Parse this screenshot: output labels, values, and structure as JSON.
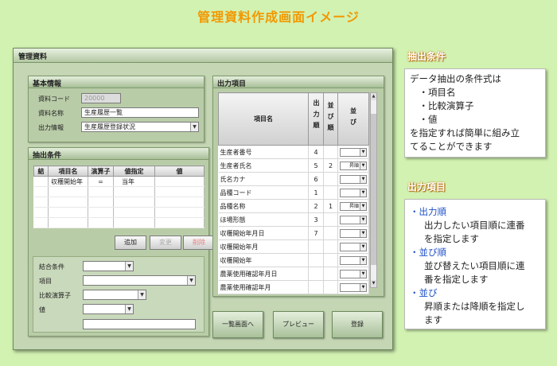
{
  "page_title": "管理資料作成画面イメージ",
  "window": {
    "title": "管理資料",
    "basic_info": {
      "header": "基本情報",
      "code_label": "資料コード",
      "code_value": "20000",
      "name_label": "資料名称",
      "name_value": "生産履歴一覧",
      "output_label": "出力情報",
      "output_value": "生産履歴登録状況"
    },
    "conditions": {
      "header": "抽出条件",
      "columns": [
        "結",
        "項目名",
        "演算子",
        "値指定",
        "値"
      ],
      "rows": [
        {
          "join": "",
          "item": "収穫開始年",
          "op": "=",
          "spec": "当年",
          "value": ""
        }
      ],
      "add_label": "追加",
      "change_label": "変更",
      "delete_label": "削除",
      "join_label": "結合条件",
      "item_label": "項目",
      "op_label": "比較演算子",
      "value_label": "値"
    },
    "output": {
      "header": "出力項目",
      "col_item": "項目名",
      "col_order": "出力順",
      "col_sort": "並び順",
      "col_dir": "並び",
      "rows": [
        {
          "name": "生産者番号",
          "order": "4",
          "sort": "",
          "dir": ""
        },
        {
          "name": "生産者氏名",
          "order": "5",
          "sort": "2",
          "dir": "昇順"
        },
        {
          "name": "氏名カナ",
          "order": "6",
          "sort": "",
          "dir": ""
        },
        {
          "name": "品種コード",
          "order": "1",
          "sort": "",
          "dir": ""
        },
        {
          "name": "品種名称",
          "order": "2",
          "sort": "1",
          "dir": "昇順"
        },
        {
          "name": "ほ場形態",
          "order": "3",
          "sort": "",
          "dir": ""
        },
        {
          "name": "収穫開始年月日",
          "order": "7",
          "sort": "",
          "dir": ""
        },
        {
          "name": "収穫開始年月",
          "order": "",
          "sort": "",
          "dir": ""
        },
        {
          "name": "収穫開始年",
          "order": "",
          "sort": "",
          "dir": ""
        },
        {
          "name": "農薬使用確認年月日",
          "order": "",
          "sort": "",
          "dir": ""
        },
        {
          "name": "農薬使用確認年月",
          "order": "",
          "sort": "",
          "dir": ""
        }
      ]
    },
    "buttons": {
      "list": "一覧画面へ",
      "preview": "プレビュー",
      "register": "登録"
    }
  },
  "side": {
    "cond_head": "抽出条件",
    "cond_lines": [
      "データ抽出の条件式は",
      "　・項目名",
      "　・比較演算子",
      "　・値",
      "を指定すれば簡単に組み立",
      "てることができます"
    ],
    "out_head": "出力項目",
    "out_items": [
      {
        "title": "・出力順",
        "desc": [
          "出力したい項目順に連番",
          "を指定します"
        ]
      },
      {
        "title": "・並び順",
        "desc": [
          "並び替えたい項目順に連",
          "番を指定します"
        ]
      },
      {
        "title": "・並び",
        "desc": [
          "昇順または降順を指定し",
          "ます"
        ]
      }
    ]
  }
}
